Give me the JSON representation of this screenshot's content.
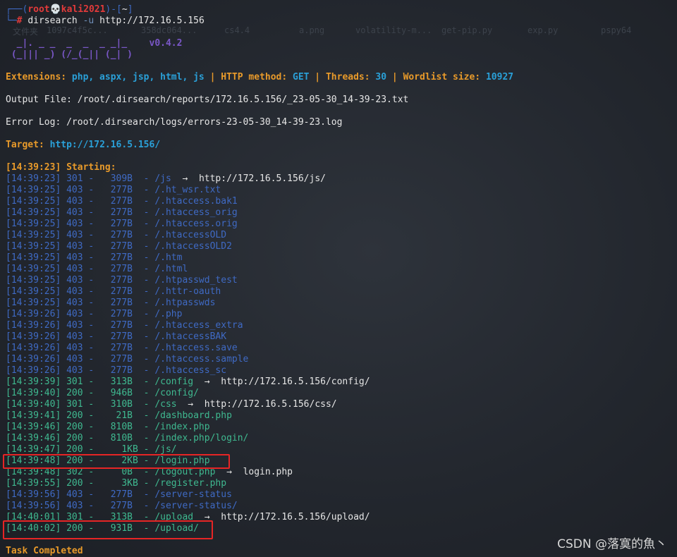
{
  "prompt": {
    "top_prefix": "┌──(",
    "user": "root💀kali2021",
    "mid": ")-[",
    "dir": "~",
    "end": "]",
    "bottom_prefix": "└─",
    "hash": "# ",
    "command": "dirsearch",
    "flag": " -u",
    "url": " http://172.16.5.156"
  },
  "ghost_text": [
    "文件夹",
    "1097c4f5c...",
    "358dc064...",
    "cs4.4",
    "a.png",
    "volatility-m...",
    "get-pip.py",
    "exp.py",
    "pspy64"
  ],
  "banner": {
    "line1": "  _|. _ _  _  _  _ _|_    ",
    "line2": " (_||| _) (/_(_|| (_| )   ",
    "version": "v0.4.2"
  },
  "summary": {
    "ext_label": "Extensions: ",
    "ext_value": "php, aspx, jsp, html, js",
    "method_label": "HTTP method: ",
    "method_value": "GET",
    "threads_label": "Threads: ",
    "threads_value": "30",
    "wordlist_label": "Wordlist size: ",
    "wordlist_value": "10927",
    "separator": " | "
  },
  "output_file": "Output File: /root/.dirsearch/reports/172.16.5.156/_23-05-30_14-39-23.txt",
  "error_log": "Error Log: /root/.dirsearch/logs/errors-23-05-30_14-39-23.log",
  "target": {
    "label": "Target: ",
    "value": "http://172.16.5.156/"
  },
  "starting": "[14:39:23] Starting: ",
  "rows": [
    {
      "text": "[14:39:23] 301 -   309B  - /js",
      "color": "blue",
      "redirect": "http://172.16.5.156/js/"
    },
    {
      "text": "[14:39:25] 403 -   277B  - /.ht_wsr.txt",
      "color": "blue"
    },
    {
      "text": "[14:39:25] 403 -   277B  - /.htaccess.bak1",
      "color": "blue"
    },
    {
      "text": "[14:39:25] 403 -   277B  - /.htaccess_orig",
      "color": "blue"
    },
    {
      "text": "[14:39:25] 403 -   277B  - /.htaccess.orig",
      "color": "blue"
    },
    {
      "text": "[14:39:25] 403 -   277B  - /.htaccessOLD",
      "color": "blue"
    },
    {
      "text": "[14:39:25] 403 -   277B  - /.htaccessOLD2",
      "color": "blue"
    },
    {
      "text": "[14:39:25] 403 -   277B  - /.htm",
      "color": "blue"
    },
    {
      "text": "[14:39:25] 403 -   277B  - /.html",
      "color": "blue"
    },
    {
      "text": "[14:39:25] 403 -   277B  - /.htpasswd_test",
      "color": "blue"
    },
    {
      "text": "[14:39:25] 403 -   277B  - /.httr-oauth",
      "color": "blue"
    },
    {
      "text": "[14:39:25] 403 -   277B  - /.htpasswds",
      "color": "blue"
    },
    {
      "text": "[14:39:26] 403 -   277B  - /.php",
      "color": "blue"
    },
    {
      "text": "[14:39:26] 403 -   277B  - /.htaccess_extra",
      "color": "blue"
    },
    {
      "text": "[14:39:26] 403 -   277B  - /.htaccessBAK",
      "color": "blue"
    },
    {
      "text": "[14:39:26] 403 -   277B  - /.htaccess.save",
      "color": "blue"
    },
    {
      "text": "[14:39:26] 403 -   277B  - /.htaccess.sample",
      "color": "blue"
    },
    {
      "text": "[14:39:26] 403 -   277B  - /.htaccess_sc",
      "color": "blue"
    },
    {
      "text": "[14:39:39] 301 -   313B  - /config",
      "color": "green",
      "redirect": "http://172.16.5.156/config/"
    },
    {
      "text": "[14:39:40] 200 -   946B  - /config/",
      "color": "green"
    },
    {
      "text": "[14:39:40] 301 -   310B  - /css",
      "color": "green",
      "redirect": "http://172.16.5.156/css/"
    },
    {
      "text": "[14:39:41] 200 -    21B  - /dashboard.php",
      "color": "green"
    },
    {
      "text": "[14:39:46] 200 -   810B  - /index.php",
      "color": "green"
    },
    {
      "text": "[14:39:46] 200 -   810B  - /index.php/login/",
      "color": "green"
    },
    {
      "text": "[14:39:47] 200 -     1KB - /js/",
      "color": "green"
    },
    {
      "text": "[14:39:48] 200 -     2KB - /login.php",
      "color": "green"
    },
    {
      "text": "[14:39:48] 302 -     0B  - /logout.php",
      "color": "green",
      "redirect": "login.php"
    },
    {
      "text": "[14:39:55] 200 -     3KB - /register.php",
      "color": "green"
    },
    {
      "text": "[14:39:56] 403 -   277B  - /server-status",
      "color": "blue"
    },
    {
      "text": "[14:39:56] 403 -   277B  - /server-status/",
      "color": "blue"
    },
    {
      "text": "[14:40:01] 301 -   313B  - /upload",
      "color": "green",
      "redirect": "http://172.16.5.156/upload/"
    },
    {
      "text": "[14:40:02] 200 -   931B  - /upload/",
      "color": "green"
    }
  ],
  "arrow": "  →  ",
  "task_completed": "Task Completed",
  "watermark": "CSDN @落寞的魚丶",
  "colors": {
    "prompt_blue": "#3f6ac4",
    "prompt_red": "#e23a3a",
    "banner_purple": "#7a57c7",
    "label_orange": "#e89a2a",
    "value_blue": "#2aa0d8",
    "status_green": "#3fb990",
    "highlight_red": "#e62525"
  }
}
